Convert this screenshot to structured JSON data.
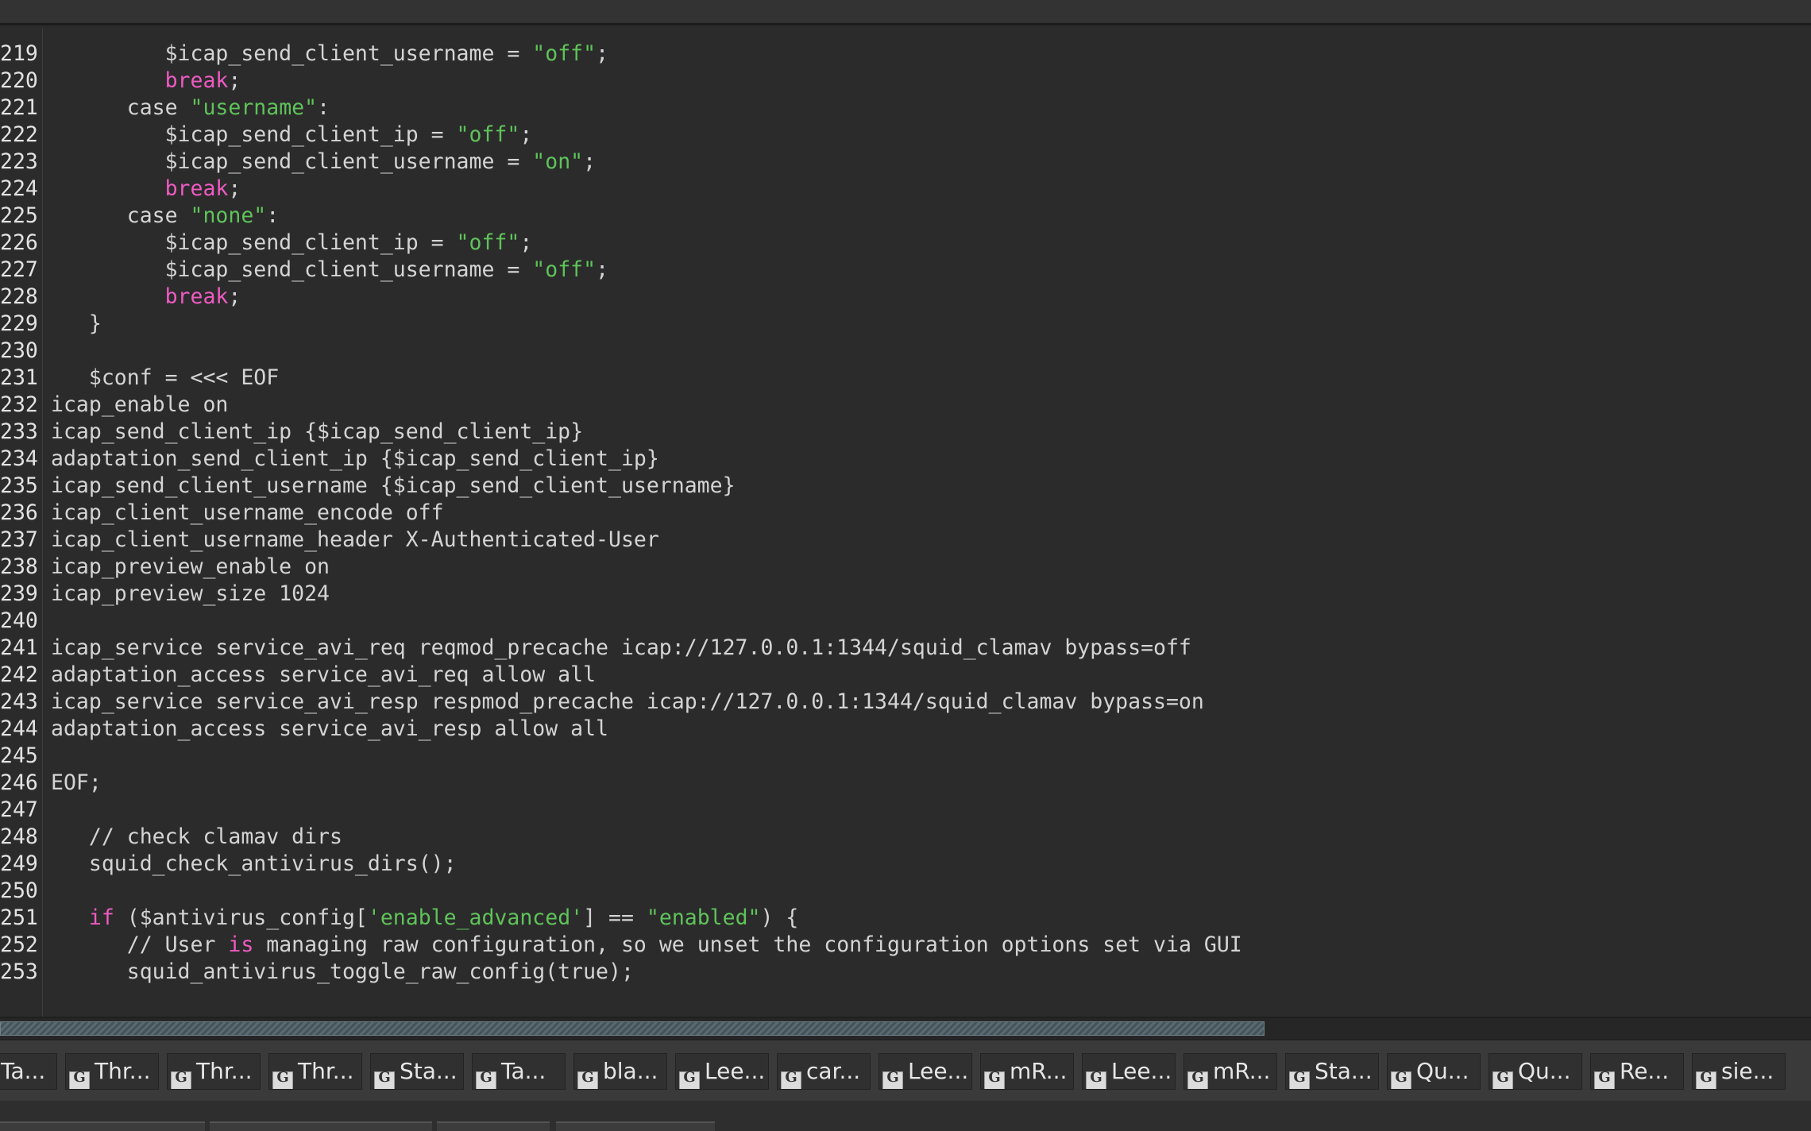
{
  "editor": {
    "lines": [
      {
        "num": "219",
        "indent": "         ",
        "parts": [
          {
            "t": "$icap_send_client_username = "
          },
          {
            "t": "\"off\"",
            "c": "str"
          },
          {
            "t": ";"
          }
        ]
      },
      {
        "num": "220",
        "indent": "         ",
        "parts": [
          {
            "t": "break",
            "c": "kw"
          },
          {
            "t": ";"
          }
        ]
      },
      {
        "num": "221",
        "indent": "      ",
        "parts": [
          {
            "t": "case "
          },
          {
            "t": "\"username\"",
            "c": "str"
          },
          {
            "t": ":"
          }
        ]
      },
      {
        "num": "222",
        "indent": "         ",
        "parts": [
          {
            "t": "$icap_send_client_ip = "
          },
          {
            "t": "\"off\"",
            "c": "str"
          },
          {
            "t": ";"
          }
        ]
      },
      {
        "num": "223",
        "indent": "         ",
        "parts": [
          {
            "t": "$icap_send_client_username = "
          },
          {
            "t": "\"on\"",
            "c": "str"
          },
          {
            "t": ";"
          }
        ]
      },
      {
        "num": "224",
        "indent": "         ",
        "parts": [
          {
            "t": "break",
            "c": "kw"
          },
          {
            "t": ";"
          }
        ]
      },
      {
        "num": "225",
        "indent": "      ",
        "parts": [
          {
            "t": "case "
          },
          {
            "t": "\"none\"",
            "c": "str"
          },
          {
            "t": ":"
          }
        ]
      },
      {
        "num": "226",
        "indent": "         ",
        "parts": [
          {
            "t": "$icap_send_client_ip = "
          },
          {
            "t": "\"off\"",
            "c": "str"
          },
          {
            "t": ";"
          }
        ]
      },
      {
        "num": "227",
        "indent": "         ",
        "parts": [
          {
            "t": "$icap_send_client_username = "
          },
          {
            "t": "\"off\"",
            "c": "str"
          },
          {
            "t": ";"
          }
        ]
      },
      {
        "num": "228",
        "indent": "         ",
        "parts": [
          {
            "t": "break",
            "c": "kw"
          },
          {
            "t": ";"
          }
        ]
      },
      {
        "num": "229",
        "indent": "   ",
        "parts": [
          {
            "t": "}"
          }
        ]
      },
      {
        "num": "230",
        "indent": "",
        "parts": []
      },
      {
        "num": "231",
        "indent": "   ",
        "parts": [
          {
            "t": "$conf = <<< EOF"
          }
        ]
      },
      {
        "num": "232",
        "indent": "",
        "parts": [
          {
            "t": "icap_enable on"
          }
        ]
      },
      {
        "num": "233",
        "indent": "",
        "parts": [
          {
            "t": "icap_send_client_ip {$icap_send_client_ip}"
          }
        ]
      },
      {
        "num": "234",
        "indent": "",
        "parts": [
          {
            "t": "adaptation_send_client_ip {$icap_send_client_ip}"
          }
        ]
      },
      {
        "num": "235",
        "indent": "",
        "parts": [
          {
            "t": "icap_send_client_username {$icap_send_client_username}"
          }
        ]
      },
      {
        "num": "236",
        "indent": "",
        "parts": [
          {
            "t": "icap_client_username_encode off"
          }
        ]
      },
      {
        "num": "237",
        "indent": "",
        "parts": [
          {
            "t": "icap_client_username_header X-Authenticated-User"
          }
        ]
      },
      {
        "num": "238",
        "indent": "",
        "parts": [
          {
            "t": "icap_preview_enable on"
          }
        ]
      },
      {
        "num": "239",
        "indent": "",
        "parts": [
          {
            "t": "icap_preview_size 1024"
          }
        ]
      },
      {
        "num": "240",
        "indent": "",
        "parts": []
      },
      {
        "num": "241",
        "indent": "",
        "parts": [
          {
            "t": "icap_service service_avi_req reqmod_precache icap://127.0.0.1:1344/squid_clamav bypass=off"
          }
        ]
      },
      {
        "num": "242",
        "indent": "",
        "parts": [
          {
            "t": "adaptation_access service_avi_req allow all"
          }
        ]
      },
      {
        "num": "243",
        "indent": "",
        "parts": [
          {
            "t": "icap_service service_avi_resp respmod_precache icap://127.0.0.1:1344/squid_clamav bypass=on"
          }
        ]
      },
      {
        "num": "244",
        "indent": "",
        "parts": [
          {
            "t": "adaptation_access service_avi_resp allow all"
          }
        ]
      },
      {
        "num": "245",
        "indent": "",
        "parts": []
      },
      {
        "num": "246",
        "indent": "",
        "parts": [
          {
            "t": "EOF;"
          }
        ]
      },
      {
        "num": "247",
        "indent": "",
        "parts": []
      },
      {
        "num": "248",
        "indent": "   ",
        "parts": [
          {
            "t": "// check clamav dirs"
          }
        ]
      },
      {
        "num": "249",
        "indent": "   ",
        "parts": [
          {
            "t": "squid_check_antivirus_dirs();"
          }
        ]
      },
      {
        "num": "250",
        "indent": "",
        "parts": []
      },
      {
        "num": "251",
        "indent": "   ",
        "parts": [
          {
            "t": "if",
            "c": "kw"
          },
          {
            "t": " ($antivirus_config["
          },
          {
            "t": "'enable_advanced'",
            "c": "str"
          },
          {
            "t": "] == "
          },
          {
            "t": "\"enabled\"",
            "c": "str"
          },
          {
            "t": ") {"
          }
        ]
      },
      {
        "num": "252",
        "indent": "      ",
        "parts": [
          {
            "t": "// User "
          },
          {
            "t": "is",
            "c": "kw"
          },
          {
            "t": " managing raw configuration, so we unset the configuration options set via GUI"
          }
        ]
      },
      {
        "num": "253",
        "indent": "      ",
        "parts": [
          {
            "t": "squid_antivirus_toggle_raw_config(true);"
          }
        ]
      }
    ]
  },
  "taskbar": {
    "icon_name": "csd-document-icon",
    "icon_glyph": "G",
    "tabs": [
      "Ta...",
      "Thr...",
      "Thr...",
      "Thr...",
      "Sta...",
      "Ta...",
      "bla...",
      "Lee...",
      "car...",
      "Lee...",
      "mR...",
      "Lee...",
      "mR...",
      "Sta...",
      "Qu...",
      "Qu...",
      "Re...",
      "sie..."
    ]
  }
}
